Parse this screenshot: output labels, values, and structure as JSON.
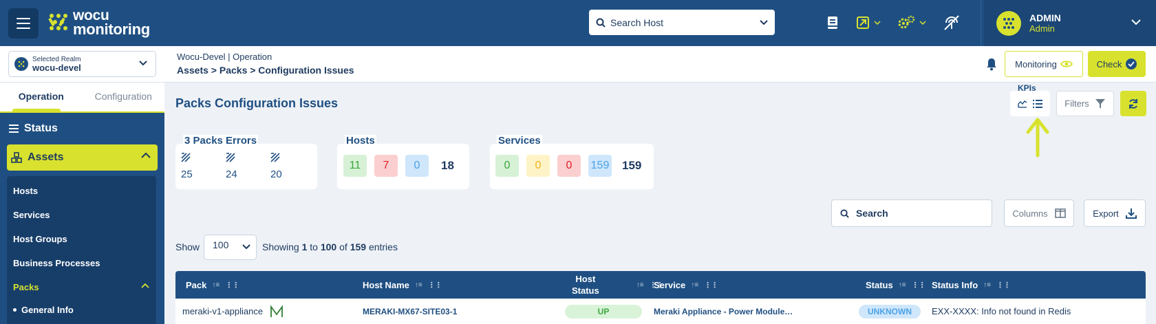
{
  "header": {
    "logo_line1": "wocu",
    "logo_line2": "monitoring",
    "search_host_placeholder": "Search Host",
    "user_name": "ADMIN",
    "user_role": "Admin"
  },
  "subbar": {
    "realm_label": "Selected Realm",
    "realm_value": "wocu-devel",
    "breadcrumb_top": "Wocu-Devel | Operation",
    "breadcrumb_path": "Assets > Packs > Configuration Issues",
    "monitoring_label": "Monitoring",
    "check_label": "Check"
  },
  "sidebar": {
    "tabs": [
      {
        "label": "Operation"
      },
      {
        "label": "Configuration"
      }
    ],
    "status_label": "Status",
    "assets_label": "Assets",
    "items": [
      {
        "label": "Hosts"
      },
      {
        "label": "Services"
      },
      {
        "label": "Host Groups"
      },
      {
        "label": "Business Processes"
      },
      {
        "label": "Packs"
      }
    ],
    "subitem": "General Info"
  },
  "main": {
    "title": "Packs Configuration Issues",
    "kpis_label": "KPIs",
    "filters_label": "Filters",
    "packs_errors": {
      "title": "3 Packs Errors",
      "values": [
        "25",
        "24",
        "20"
      ]
    },
    "hosts": {
      "title": "Hosts",
      "values": [
        "11",
        "7",
        "0"
      ],
      "total": "18"
    },
    "services": {
      "title": "Services",
      "values": [
        "0",
        "0",
        "0",
        "159"
      ],
      "total": "159"
    },
    "search_placeholder": "Search",
    "columns_label": "Columns",
    "export_label": "Export",
    "show_label": "Show",
    "page_size": "100",
    "showing_prefix": "Showing",
    "showing_from": "1",
    "showing_to_word": "to",
    "showing_to": "100",
    "showing_of_word": "of",
    "showing_total": "159",
    "showing_suffix": "entries"
  },
  "table": {
    "columns": [
      "Pack",
      "Host Name",
      "Host",
      "Status",
      "Service",
      "Status",
      "Status Info"
    ],
    "rows": [
      {
        "pack": "meraki-v1-appliance",
        "host_name": "MERAKI-MX67-SITE03-1",
        "host_status": "UP",
        "service": "Meraki Appliance - Power Module…",
        "status": "UNKNOWN",
        "status_info": "EXX-XXXX: Info not found in Redis"
      }
    ]
  },
  "colors": {
    "brand_blue": "#1f4f82",
    "accent_yellow": "#d8e22e",
    "ok_green": "#3ca63c",
    "critical_red": "#e0202a",
    "warning_yellow": "#f2b21c",
    "unknown_blue": "#4aa3e8"
  }
}
